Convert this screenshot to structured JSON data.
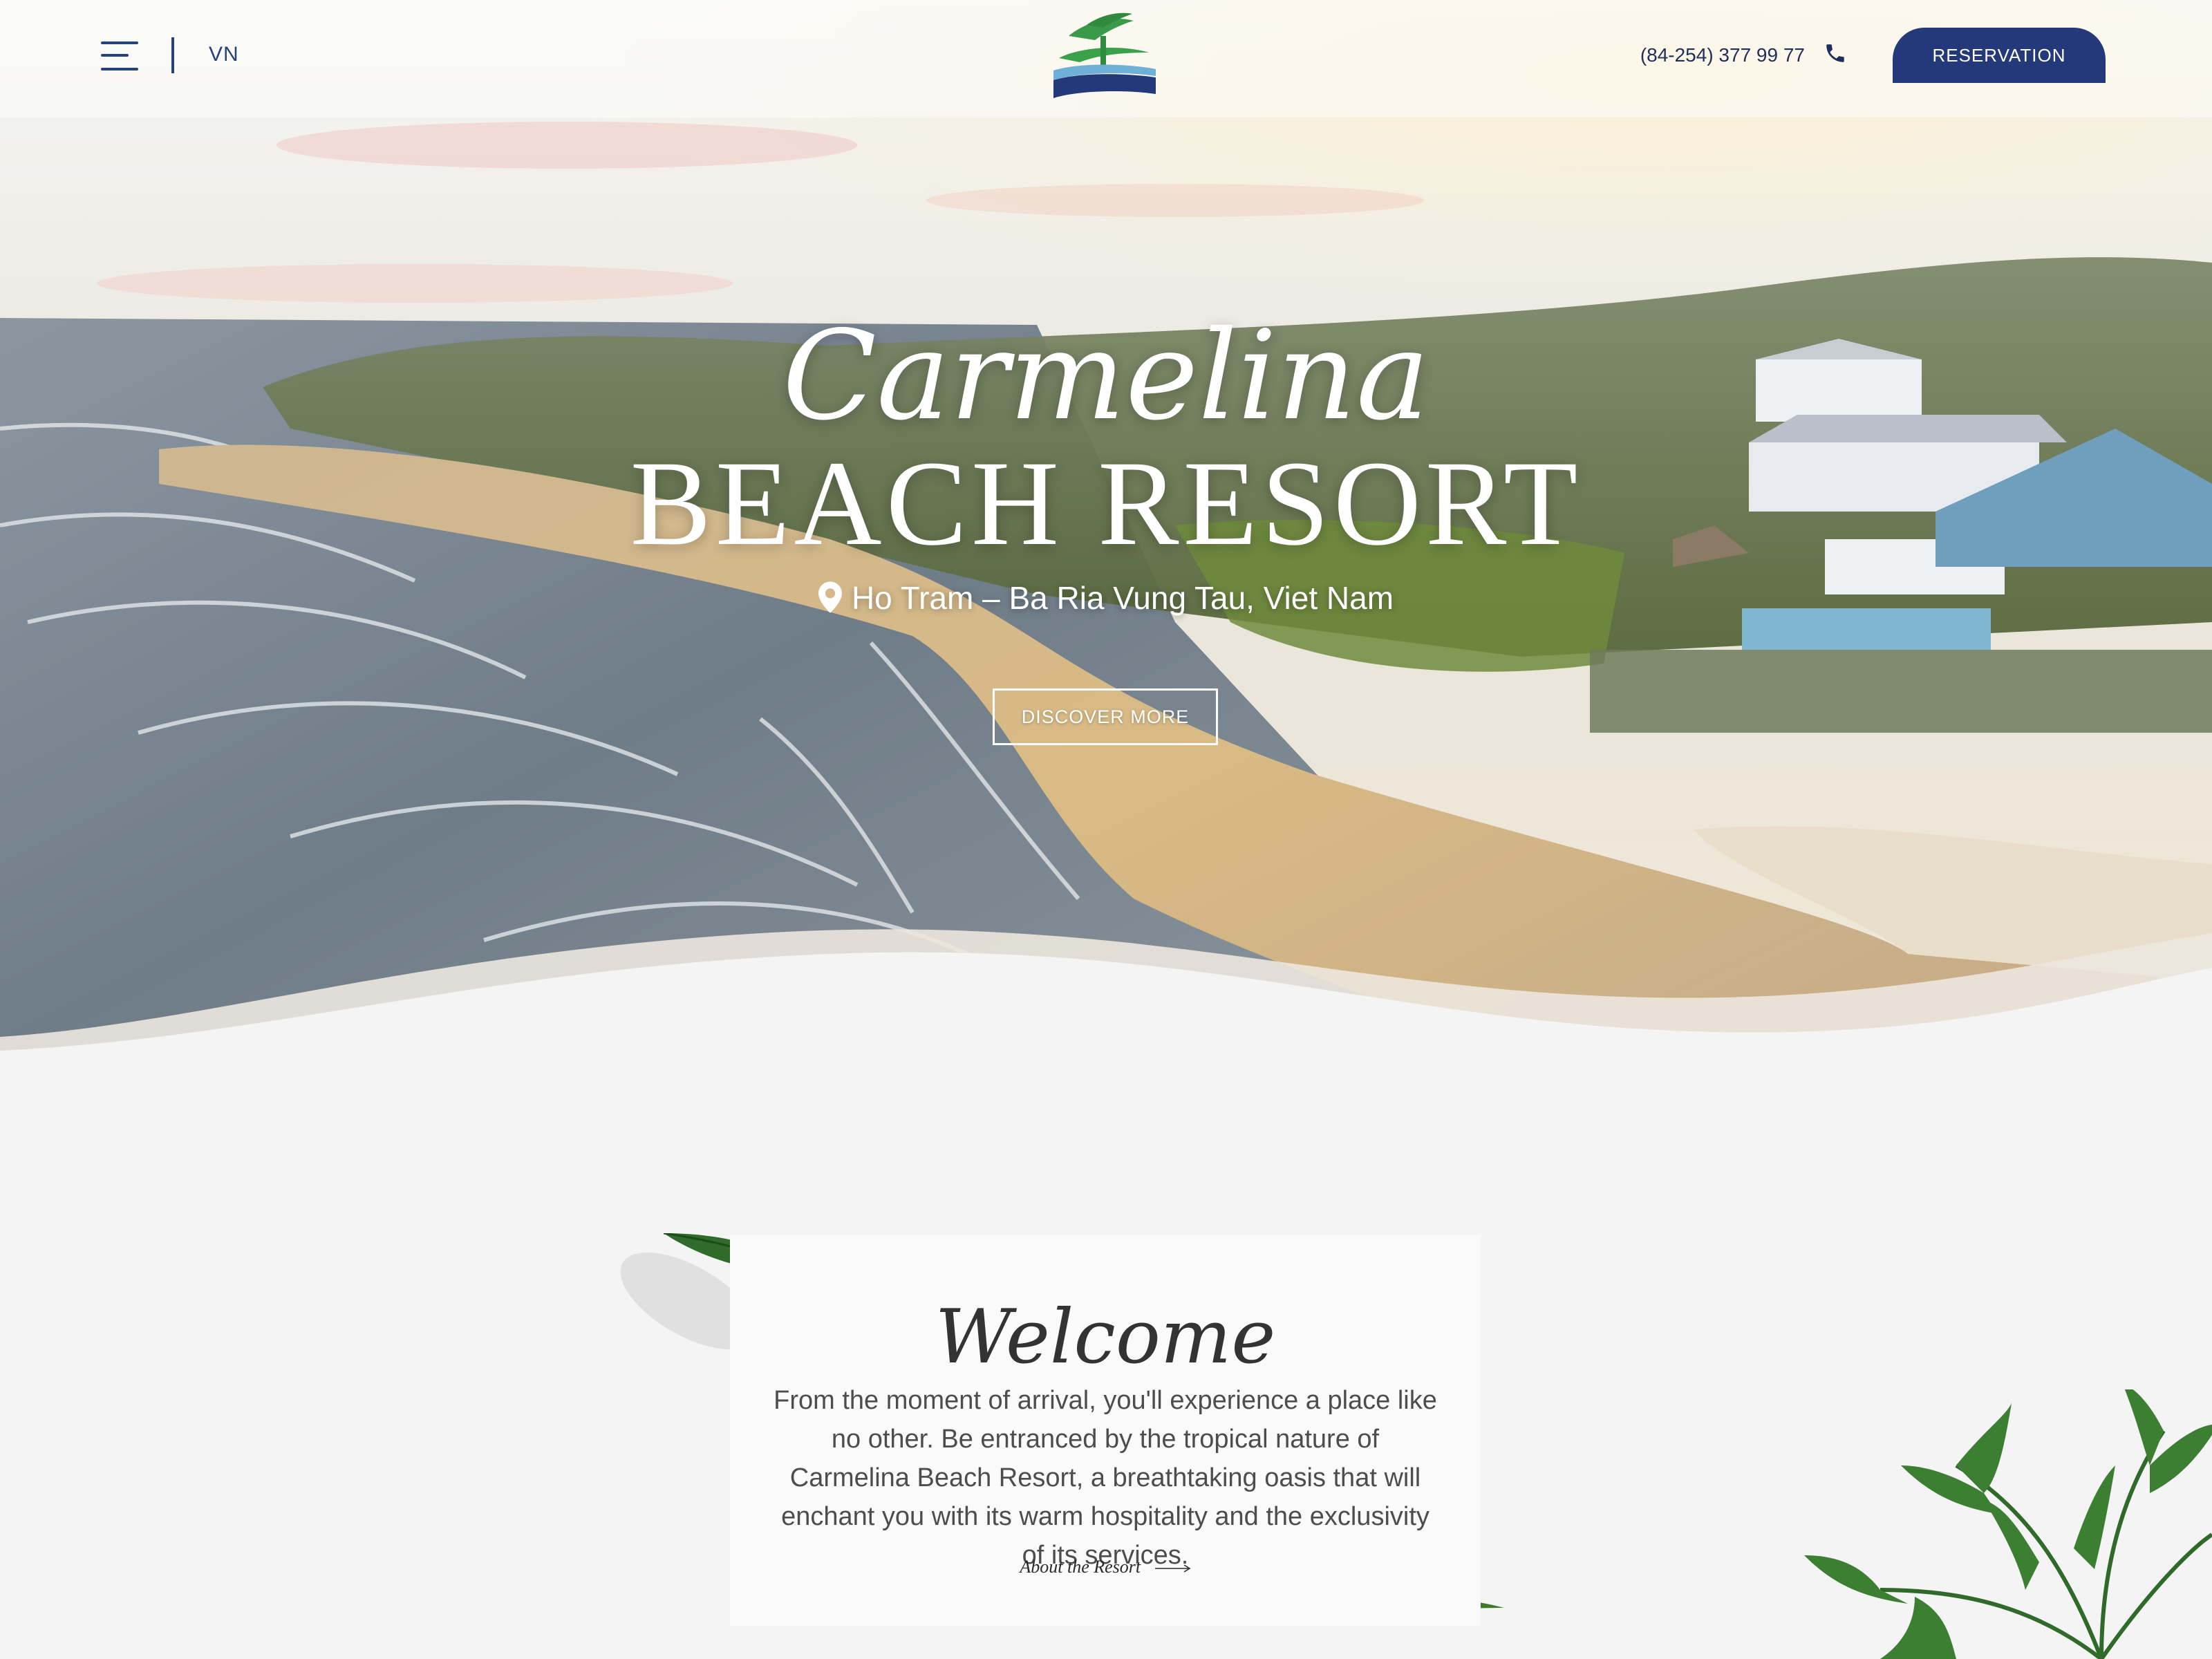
{
  "header": {
    "language": "VN",
    "phone": "(84-254) 377 99 77",
    "reservation_label": "RESERVATION"
  },
  "hero": {
    "script_title": "Carmelina",
    "title": "BEACH RESORT",
    "location": "Ho Tram – Ba Ria Vung Tau, Viet Nam",
    "cta_label": "DISCOVER MORE"
  },
  "welcome": {
    "title": "Welcome",
    "text": "From the moment of arrival, you'll experience a place like no other. Be entranced by the tropical nature of Carmelina Beach Resort, a breathtaking oasis that will enchant you with its warm hospitality and the exclusivity of its services.",
    "link_label": "About the Resort"
  },
  "icons": {
    "menu": "hamburger-menu-icon",
    "phone": "phone-icon",
    "location": "map-pin-icon",
    "arrow": "arrow-right-icon"
  },
  "colors": {
    "brand_navy": "#23397a",
    "brand_green": "#2e8b3e",
    "page_background": "#f4f4f4"
  }
}
